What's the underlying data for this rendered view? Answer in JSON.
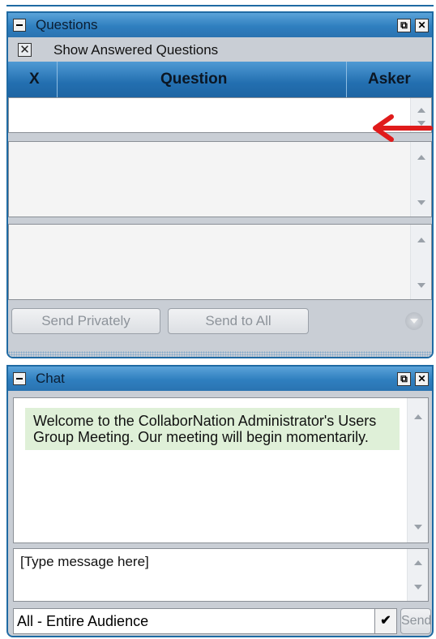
{
  "questions_panel": {
    "title": "Questions",
    "restore_glyph": "⧉",
    "close_glyph": "✕",
    "show_answered_label": "Show Answered Questions",
    "show_answered_checked": true,
    "columns": [
      "X",
      "Question",
      "Asker"
    ],
    "send_privately_label": "Send Privately",
    "send_to_all_label": "Send to All"
  },
  "chat_panel": {
    "title": "Chat",
    "restore_glyph": "⧉",
    "close_glyph": "✕",
    "message": "Welcome to the CollaborNation Administrator's Users Group Meeting. Our meeting will begin momentarily.",
    "input_value": "[Type message here]",
    "audience_value": "All - Entire Audience",
    "send_label": "Send"
  },
  "colors": {
    "titlebar_blue": "#2f7fbf",
    "panel_border": "#1f6aa3",
    "message_bg": "#dff0d8",
    "annotation_red": "#e01b1b"
  },
  "icons": {
    "collapse": "minus-icon",
    "restore": "restore-window-icon",
    "close": "close-icon",
    "scroll_up": "chevron-up-icon",
    "scroll_down": "chevron-down-icon",
    "annotation": "red-arrow-icon"
  }
}
